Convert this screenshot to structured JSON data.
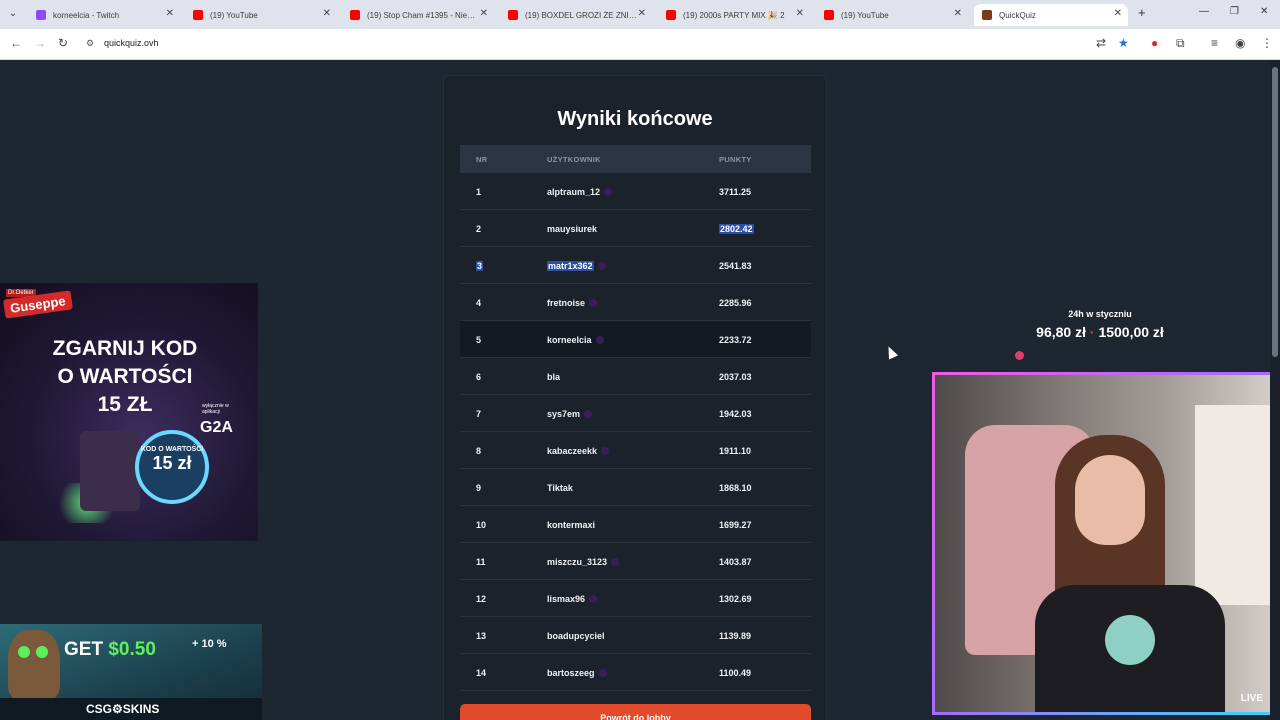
{
  "browser": {
    "tabs": [
      {
        "label": "korneelcia - Twitch",
        "color": "#9146ff"
      },
      {
        "label": "(19) YouTube",
        "color": "#ff0000"
      },
      {
        "label": "(19) Stop Cham #1395 - Nieben",
        "color": "#ff0000"
      },
      {
        "label": "(19) BOXDEL GROZI ŻE ZNISZC",
        "color": "#ff0000"
      },
      {
        "label": "(19) 2000s PARTY MIX 🎉 2",
        "color": "#ff0000"
      },
      {
        "label": "(19) YouTube",
        "color": "#ff0000"
      },
      {
        "label": "QuickQuiz",
        "color": "#7a3b1a"
      }
    ],
    "url": "quickquiz.ovh"
  },
  "results": {
    "title": "Wyniki końcowe",
    "headers": {
      "nr": "NR",
      "user": "UŻYTKOWNIK",
      "points": "PUNKTY"
    },
    "rows": [
      {
        "nr": "1",
        "user": "alptraum_12",
        "points": "3711.25",
        "dot": true
      },
      {
        "nr": "2",
        "user": "mauysiurek",
        "points": "2802.42",
        "dot": false
      },
      {
        "nr": "3",
        "user": "matr1x362",
        "points": "2541.83",
        "dot": true
      },
      {
        "nr": "4",
        "user": "fretnoise",
        "points": "2285.96",
        "dot": true
      },
      {
        "nr": "5",
        "user": "korneelcia",
        "points": "2233.72",
        "dot": true
      },
      {
        "nr": "6",
        "user": "bla",
        "points": "2037.03",
        "dot": false
      },
      {
        "nr": "7",
        "user": "sys7em",
        "points": "1942.03",
        "dot": true
      },
      {
        "nr": "8",
        "user": "kabaczeekk",
        "points": "1911.10",
        "dot": true
      },
      {
        "nr": "9",
        "user": "Tiktak",
        "points": "1868.10",
        "dot": false
      },
      {
        "nr": "10",
        "user": "kontermaxi",
        "points": "1699.27",
        "dot": false
      },
      {
        "nr": "11",
        "user": "miszczu_3123",
        "points": "1403.87",
        "dot": true
      },
      {
        "nr": "12",
        "user": "lismax96",
        "points": "1302.69",
        "dot": true
      },
      {
        "nr": "13",
        "user": "boadupcyciel",
        "points": "1139.89",
        "dot": false
      },
      {
        "nr": "14",
        "user": "bartoszeeg",
        "points": "1100.49",
        "dot": true
      }
    ],
    "lobby_button": "Powrót do lobby"
  },
  "ads": {
    "g2a": {
      "brand_small": "Dr.Oetker",
      "brand": "Guseppe",
      "headline_1": "ZGARNIJ KOD",
      "headline_2": "O WARTOŚCI",
      "headline_3": "15 ZŁ",
      "only": "wyłącznie w aplikacji",
      "logo": "G2A",
      "badge_top": "KOD O WARTOŚCI",
      "badge_value": "15 zł"
    },
    "csgo": {
      "get": "GET",
      "money": "$0.50",
      "bonus": "+ 10 %",
      "logo": "CSG⚙SKINS"
    }
  },
  "stream": {
    "goal_title": "24h w styczniu",
    "goal_current": "96,80 zł",
    "goal_target": "1500,00 zł",
    "live": "LIVE"
  }
}
